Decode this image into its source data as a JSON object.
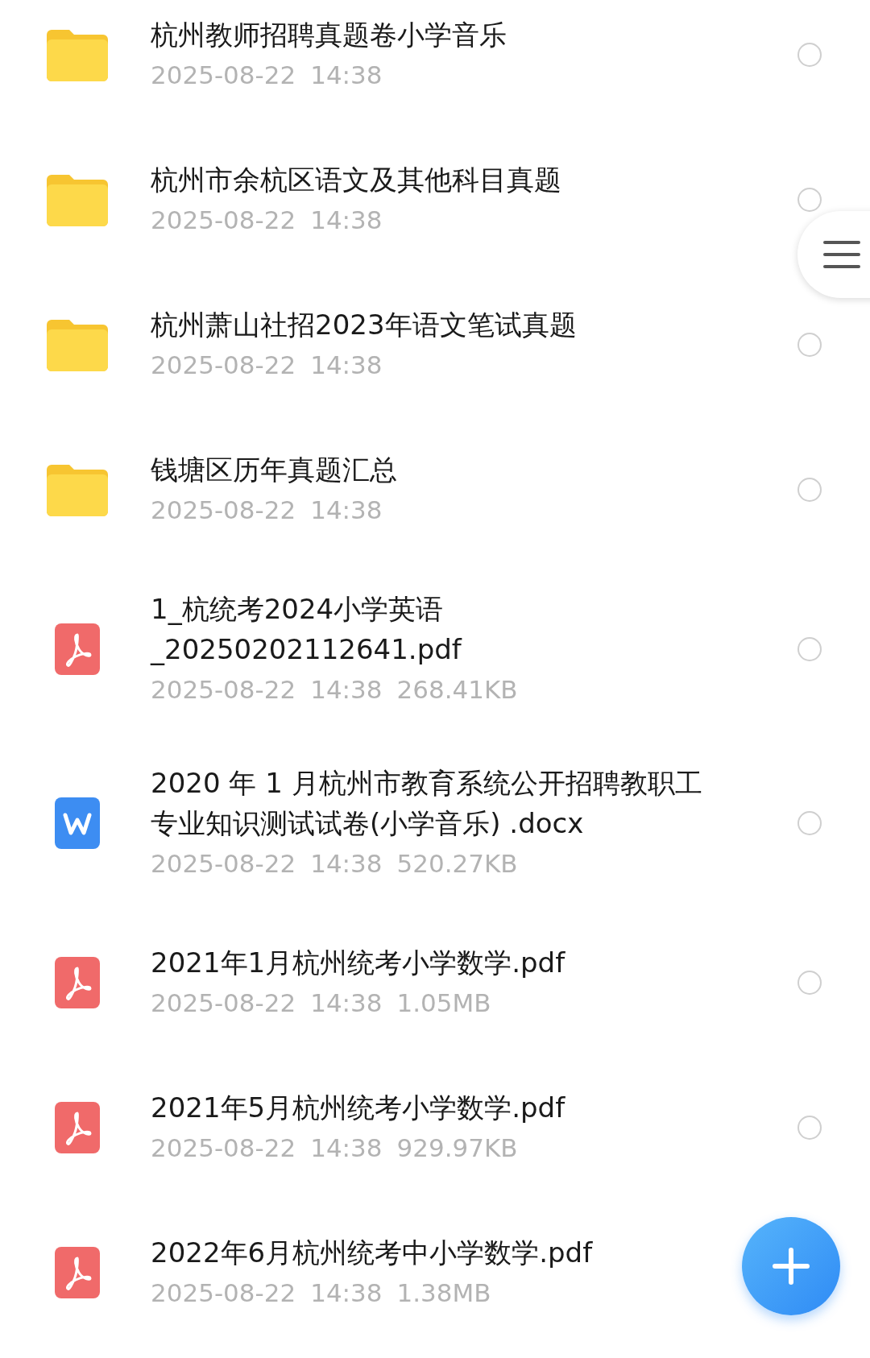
{
  "files": [
    {
      "kind": "folder",
      "title_lines": [
        "杭州教师招聘真题卷小学音乐"
      ],
      "date": "2025-08-22",
      "time": "14:38",
      "selected": false
    },
    {
      "kind": "folder",
      "title_lines": [
        "杭州市余杭区语文及其他科目真题"
      ],
      "date": "2025-08-22",
      "time": "14:38",
      "selected": false
    },
    {
      "kind": "folder",
      "title_lines": [
        "杭州萧山社招2023年语文笔试真题"
      ],
      "date": "2025-08-22",
      "time": "14:38",
      "selected": false
    },
    {
      "kind": "folder",
      "title_lines": [
        "钱塘区历年真题汇总"
      ],
      "date": "2025-08-22",
      "time": "14:38",
      "selected": false
    },
    {
      "kind": "pdf",
      "title_lines": [
        "1_杭统考2024小学英语",
        "_20250202112641.pdf"
      ],
      "date": "2025-08-22",
      "time": "14:38",
      "size": "268.41KB",
      "selected": false
    },
    {
      "kind": "docx",
      "title_lines": [
        "2020 年 1 月杭州市教育系统公开招聘教职工",
        "专业知识测试试卷(小学音乐) .docx"
      ],
      "date": "2025-08-22",
      "time": "14:38",
      "size": "520.27KB",
      "selected": false
    },
    {
      "kind": "pdf",
      "title_lines": [
        "2021年1月杭州统考小学数学.pdf"
      ],
      "date": "2025-08-22",
      "time": "14:38",
      "size": "1.05MB",
      "selected": false
    },
    {
      "kind": "pdf",
      "title_lines": [
        "2021年5月杭州统考小学数学.pdf"
      ],
      "date": "2025-08-22",
      "time": "14:38",
      "size": "929.97KB",
      "selected": false
    },
    {
      "kind": "pdf",
      "title_lines": [
        "2022年6月杭州统考中小学数学.pdf"
      ],
      "date": "2025-08-22",
      "time": "14:38",
      "size": "1.38MB"
    }
  ]
}
